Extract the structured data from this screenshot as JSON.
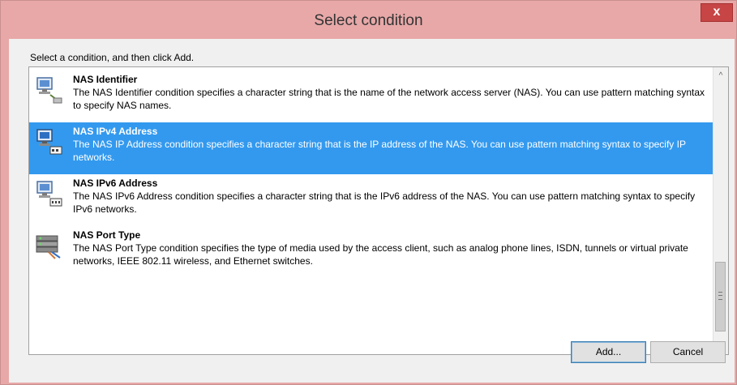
{
  "window": {
    "title": "Select condition",
    "close_glyph": "x"
  },
  "instruction": "Select a condition, and then click Add.",
  "conditions": [
    {
      "title": "NAS Identifier",
      "description": "The NAS Identifier condition specifies a character string that is the name of the network access server (NAS). You can use pattern matching syntax to specify NAS names.",
      "icon": "network-computer-icon",
      "selected": false
    },
    {
      "title": "NAS IPv4 Address",
      "description": "The NAS IP Address condition specifies a character string that is the IP address of the NAS. You can use pattern matching syntax to specify IP networks.",
      "icon": "network-computer-ipv4-icon",
      "selected": true
    },
    {
      "title": "NAS IPv6 Address",
      "description": "The NAS IPv6 Address condition specifies a character string that is the IPv6 address of the NAS. You can use pattern matching syntax to specify IPv6 networks.",
      "icon": "network-computer-ipv6-icon",
      "selected": false
    },
    {
      "title": "NAS Port Type",
      "description": "The NAS Port Type condition specifies the type of media used by the access client, such as analog phone lines, ISDN, tunnels or virtual private networks, IEEE 802.11 wireless, and Ethernet switches.",
      "icon": "port-type-icon",
      "selected": false
    }
  ],
  "scrollbar": {
    "up_glyph": "^",
    "down_glyph": "v"
  },
  "buttons": {
    "add_label": "Add...",
    "cancel_label": "Cancel"
  },
  "colors": {
    "selection": "#3399ee",
    "window_frame": "#e8a8a8",
    "close_button": "#c74545"
  }
}
